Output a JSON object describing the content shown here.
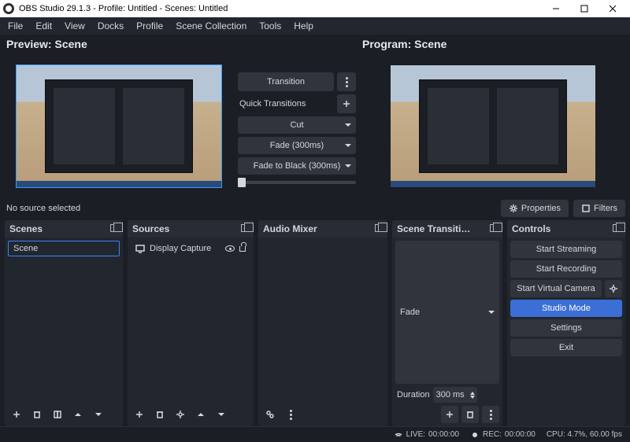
{
  "window": {
    "title": "OBS Studio 29.1.3 - Profile: Untitled - Scenes: Untitled"
  },
  "menu": [
    "File",
    "Edit",
    "View",
    "Docks",
    "Profile",
    "Scene Collection",
    "Tools",
    "Help"
  ],
  "preview": {
    "heading": "Preview: Scene"
  },
  "program": {
    "heading": "Program: Scene"
  },
  "center": {
    "transition_btn": "Transition",
    "quick_label": "Quick Transitions",
    "items": [
      "Cut",
      "Fade (300ms)",
      "Fade to Black (300ms)"
    ]
  },
  "mid": {
    "info": "No source selected",
    "properties": "Properties",
    "filters": "Filters"
  },
  "scenes": {
    "title": "Scenes",
    "items": [
      "Scene"
    ]
  },
  "sources": {
    "title": "Sources",
    "items": [
      {
        "label": "Display Capture"
      }
    ]
  },
  "mixer": {
    "title": "Audio Mixer"
  },
  "scene_transitions": {
    "title": "Scene Transiti…",
    "selected": "Fade",
    "duration_label": "Duration",
    "duration_value": "300 ms"
  },
  "controls": {
    "title": "Controls",
    "buttons": {
      "start_streaming": "Start Streaming",
      "start_recording": "Start Recording",
      "start_virtual_cam": "Start Virtual Camera",
      "studio_mode": "Studio Mode",
      "settings": "Settings",
      "exit": "Exit"
    }
  },
  "status": {
    "live_label": "LIVE:",
    "live_time": "00:00:00",
    "rec_label": "REC:",
    "rec_time": "00:00:00",
    "cpu": "CPU: 4.7%, 60.00 fps"
  }
}
